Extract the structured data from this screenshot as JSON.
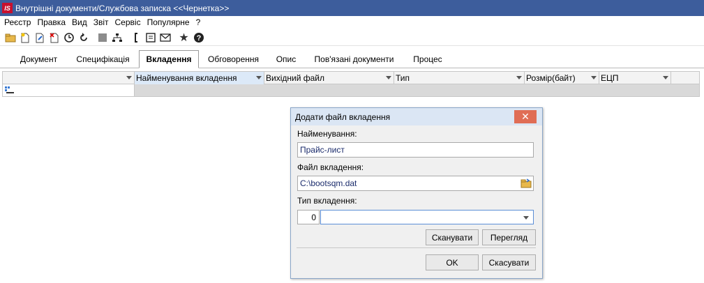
{
  "window": {
    "logo": "IS",
    "title": "Внутрішні документи/Службова записка <<Чернетка>>"
  },
  "menu": [
    "Реєстр",
    "Правка",
    "Вид",
    "Звіт",
    "Сервіс",
    "Популярне",
    "?"
  ],
  "toolbar_icons": [
    "open-folder-icon",
    "new-document-icon",
    "edit-document-icon",
    "delete-document-icon",
    "clock-icon",
    "refresh-icon",
    "stop-icon",
    "hierarchy-icon",
    "bracket-icon",
    "form-icon",
    "mail-icon",
    "star-icon",
    "help-icon"
  ],
  "tabs": [
    {
      "label": "Документ",
      "active": false
    },
    {
      "label": "Специфікація",
      "active": false
    },
    {
      "label": "Вкладення",
      "active": true
    },
    {
      "label": "Обговорення",
      "active": false
    },
    {
      "label": "Опис",
      "active": false
    },
    {
      "label": "Пов'язані документи",
      "active": false
    },
    {
      "label": "Процес",
      "active": false
    }
  ],
  "grid": {
    "columns": [
      "",
      "Найменування вкладення",
      "Вихідний файл",
      "Тип",
      "Розмір(байт)",
      "ЕЦП"
    ]
  },
  "dialog": {
    "title": "Додати файл вкладення",
    "name_label": "Найменування:",
    "name_value": "Прайс-лист",
    "file_label": "Файл вкладення:",
    "file_value": "C:\\bootsqm.dat",
    "type_label": "Тип вкладення:",
    "type_code": "0",
    "type_value": "",
    "scan_button": "Сканувати",
    "view_button": "Перегляд",
    "ok_button": "OK",
    "cancel_button": "Скасувати"
  },
  "colors": {
    "titlebar": "#3d5d9c",
    "close": "#e06d55",
    "dialog_title": "#dbe6f4"
  }
}
